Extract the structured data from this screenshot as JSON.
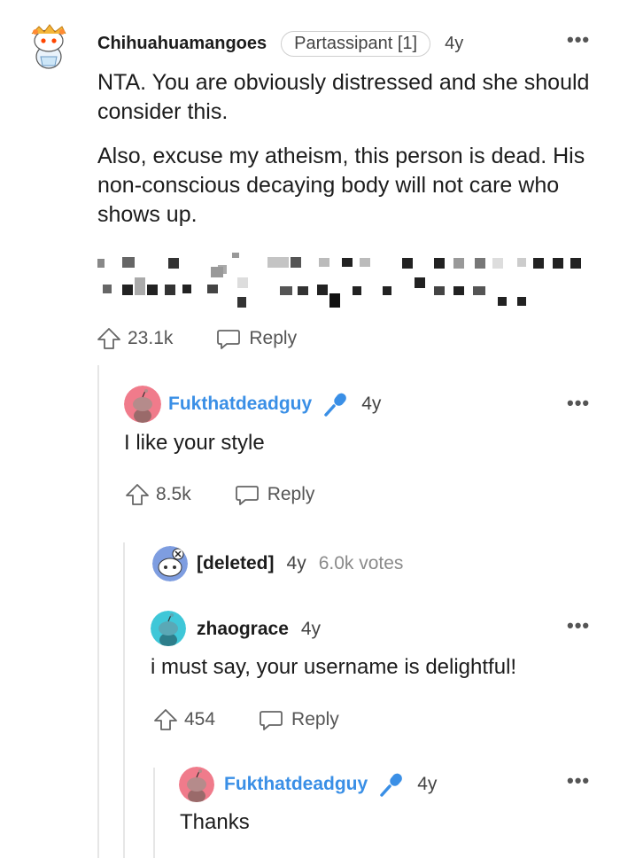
{
  "comments": [
    {
      "username": "Chihuahuamangoes",
      "flair": "Partassipant [1]",
      "time": "4y",
      "paragraphs": [
        "NTA. You are obviously distressed and she should consider this.",
        "Also, excuse my atheism, this person is dead. His non-conscious decaying body will not care who shows up."
      ],
      "upvotes": "23.1k",
      "reply_label": "Reply"
    },
    {
      "username": "Fukthatdeadguy",
      "time": "4y",
      "text": "I like your style",
      "upvotes": "8.5k",
      "reply_label": "Reply"
    },
    {
      "username": "[deleted]",
      "time": "4y",
      "votes": "6.0k votes"
    },
    {
      "username": "zhaograce",
      "time": "4y",
      "text": "i must say, your username is delightful!",
      "upvotes": "454",
      "reply_label": "Reply"
    },
    {
      "username": "Fukthatdeadguy",
      "time": "4y",
      "text": "Thanks"
    }
  ],
  "icons": {
    "more": "more-options-icon",
    "upvote": "upvote-arrow-icon",
    "reply": "reply-bubble-icon",
    "op_badge": "microphone-icon"
  },
  "more_glyph": "•••",
  "colors": {
    "op_blue": "#3a8fe6",
    "thread_line": "#e6e6e6",
    "text": "#1c1c1c",
    "muted": "#8a8a8a"
  }
}
